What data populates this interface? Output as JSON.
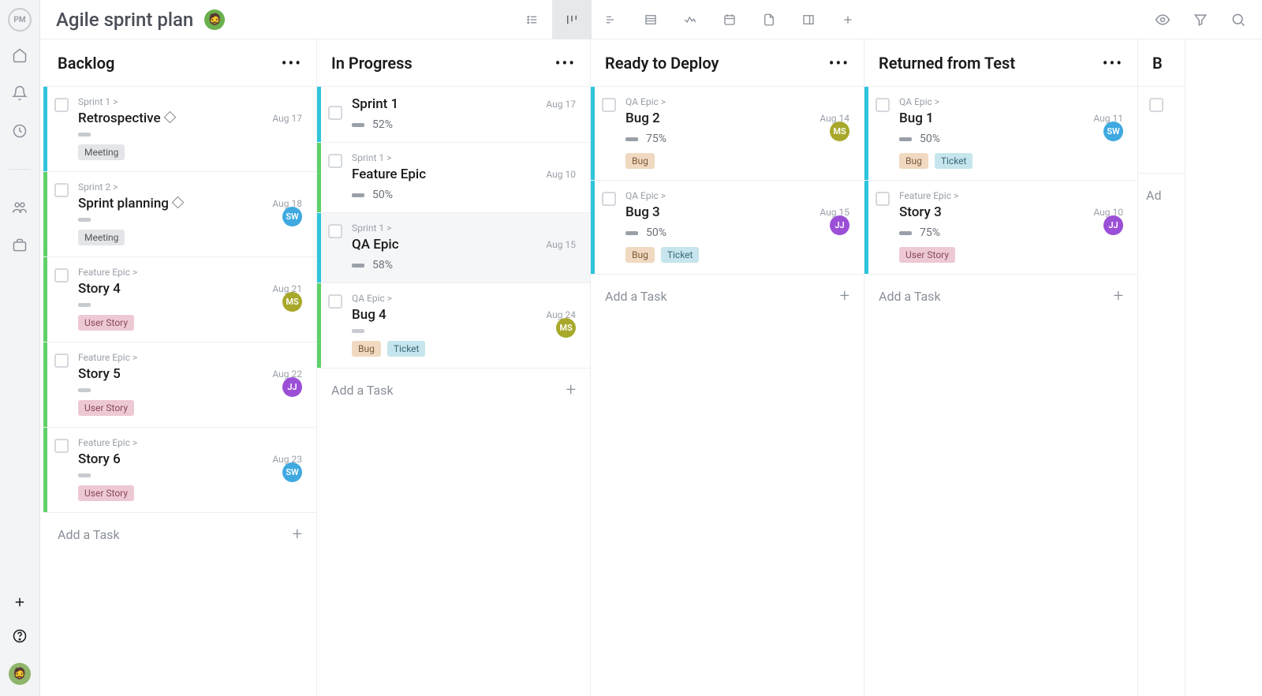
{
  "app": {
    "logo": "PM",
    "title": "Agile sprint plan"
  },
  "views": [
    "list",
    "board",
    "timeline",
    "table",
    "workload",
    "calendar",
    "file",
    "panel",
    "add"
  ],
  "columns": [
    {
      "name": "Backlog",
      "addLabel": "Add a Task",
      "cards": [
        {
          "breadcrumb": "Sprint 1 >",
          "title": "Retrospective",
          "milestone": true,
          "date": "Aug 17",
          "stripe": "blue",
          "progress": null,
          "avatar": null,
          "tags": [
            "Meeting"
          ]
        },
        {
          "breadcrumb": "Sprint 2 >",
          "title": "Sprint planning",
          "milestone": true,
          "date": "Aug 18",
          "stripe": "green",
          "progress": null,
          "avatar": "SW",
          "avclass": "av-sw",
          "tags": [
            "Meeting"
          ]
        },
        {
          "breadcrumb": "Feature Epic >",
          "title": "Story 4",
          "date": "Aug 21",
          "stripe": "green",
          "progress": null,
          "avatar": "MS",
          "avclass": "av-ms",
          "tags": [
            "User Story"
          ]
        },
        {
          "breadcrumb": "Feature Epic >",
          "title": "Story 5",
          "date": "Aug 22",
          "stripe": "green",
          "progress": null,
          "avatar": "JJ",
          "avclass": "av-jj",
          "tags": [
            "User Story"
          ]
        },
        {
          "breadcrumb": "Feature Epic >",
          "title": "Story 6",
          "date": "Aug 23",
          "stripe": "green",
          "progress": null,
          "avatar": "SW",
          "avclass": "av-sw",
          "tags": [
            "User Story"
          ]
        }
      ]
    },
    {
      "name": "In Progress",
      "addLabel": "Add a Task",
      "cards": [
        {
          "title": "Sprint 1",
          "date": "Aug 17",
          "stripe": "blue",
          "progress": "52%",
          "summary": true
        },
        {
          "breadcrumb": "Sprint 1 >",
          "title": "Feature Epic",
          "date": "Aug 10",
          "stripe": "green",
          "progress": "50%"
        },
        {
          "breadcrumb": "Sprint 1 >",
          "title": "QA Epic",
          "date": "Aug 15",
          "stripe": "blue",
          "progress": "58%",
          "selected": true
        },
        {
          "breadcrumb": "QA Epic >",
          "title": "Bug 4",
          "date": "Aug 24",
          "stripe": "green",
          "progress": null,
          "avatar": "MS",
          "avclass": "av-ms",
          "tags": [
            "Bug",
            "Ticket"
          ]
        }
      ]
    },
    {
      "name": "Ready to Deploy",
      "addLabel": "Add a Task",
      "cards": [
        {
          "breadcrumb": "QA Epic >",
          "title": "Bug 2",
          "date": "Aug 14",
          "stripe": "blue",
          "progress": "75%",
          "avatar": "MS",
          "avclass": "av-ms",
          "tags": [
            "Bug"
          ]
        },
        {
          "breadcrumb": "QA Epic >",
          "title": "Bug 3",
          "date": "Aug 15",
          "stripe": "blue",
          "progress": "50%",
          "avatar": "JJ",
          "avclass": "av-jj",
          "tags": [
            "Bug",
            "Ticket"
          ]
        }
      ]
    },
    {
      "name": "Returned from Test",
      "addLabel": "Add a Task",
      "cards": [
        {
          "breadcrumb": "QA Epic >",
          "title": "Bug 1",
          "date": "Aug 11",
          "stripe": "blue",
          "progress": "50%",
          "avatar": "SW",
          "avclass": "av-sw",
          "tags": [
            "Bug",
            "Ticket"
          ]
        },
        {
          "breadcrumb": "Feature Epic >",
          "title": "Story 3",
          "date": "Aug 10",
          "stripe": "blue",
          "progress": "75%",
          "avatar": "JJ",
          "avclass": "av-jj",
          "tags": [
            "User Story"
          ]
        }
      ]
    }
  ],
  "partialColumnTitle": "B",
  "partialAdd": "Ad",
  "tagClasses": {
    "Meeting": "meeting",
    "Bug": "bug",
    "Ticket": "ticket",
    "User Story": "user-story"
  }
}
